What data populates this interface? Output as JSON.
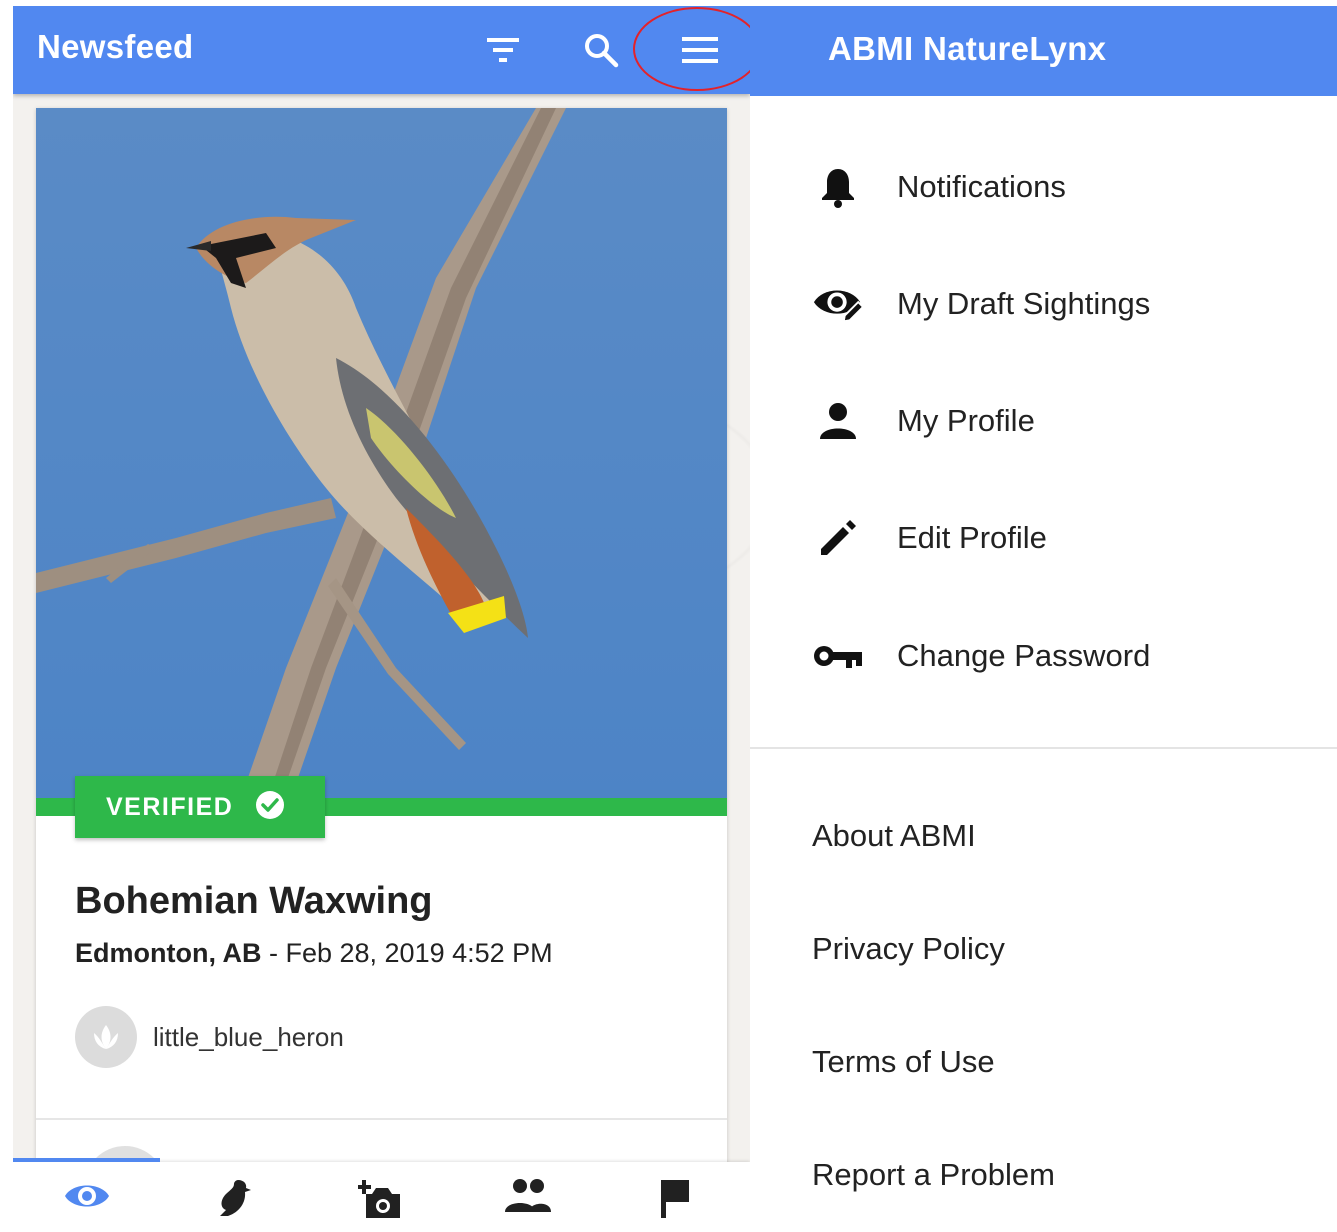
{
  "newsfeed": {
    "title": "Newsfeed",
    "icons": [
      "filter-icon",
      "search-icon",
      "menu-icon"
    ],
    "card": {
      "badge": "VERIFIED",
      "species": "Bohemian Waxwing",
      "location": "Edmonton, AB",
      "separator": " - ",
      "datetime": "Feb 28, 2019 4:52 PM",
      "username": "little_blue_heron"
    },
    "bottom_nav": [
      "eye-icon",
      "bird-icon",
      "add-photo-icon",
      "people-icon",
      "flag-icon"
    ]
  },
  "drawer": {
    "title": "ABMI NatureLynx",
    "items": [
      {
        "label": "Notifications",
        "icon": "bell-icon"
      },
      {
        "label": "My Draft Sightings",
        "icon": "eye-edit-icon"
      },
      {
        "label": "My Profile",
        "icon": "person-icon"
      },
      {
        "label": "Edit Profile",
        "icon": "pencil-icon"
      },
      {
        "label": "Change Password",
        "icon": "key-icon"
      }
    ],
    "links": [
      "About ABMI",
      "Privacy Policy",
      "Terms of Use",
      "Report a Problem"
    ]
  },
  "colors": {
    "primary": "#5188f0",
    "verified": "#2eb84a",
    "highlight": "#e3222a"
  }
}
